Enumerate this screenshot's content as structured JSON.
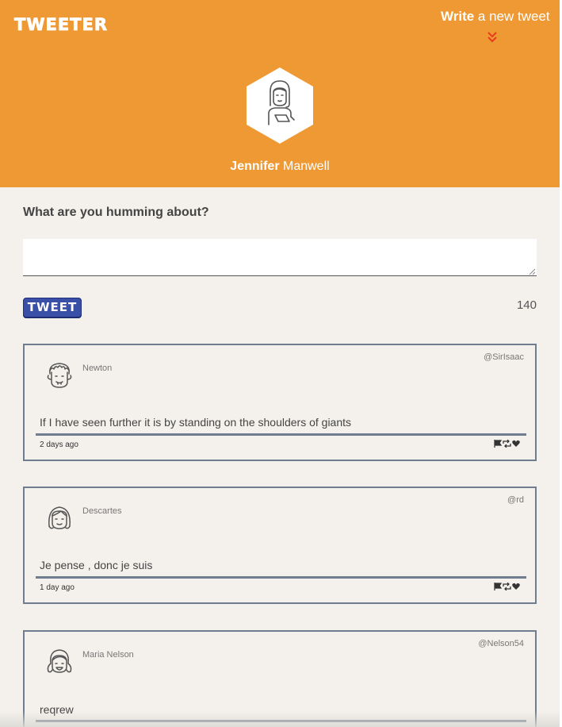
{
  "header": {
    "logo": "TWEETER",
    "write_bold": "Write",
    "write_rest": " a new tweet",
    "profile_first": "Jennifer",
    "profile_last": " Manwell",
    "icons": [
      "chevron-double-down-icon",
      "user-avatar-icon"
    ],
    "accent": "#ee9933"
  },
  "compose": {
    "label": "What are you humming about?",
    "value": "",
    "button": "TWEET",
    "counter": "140",
    "button_color": "#3a4fa6"
  },
  "tweets": [
    {
      "name": "Newton",
      "handle": "@SirIsaac",
      "text": "If I have seen further it is by standing on the shoulders of giants",
      "time": "2 days ago"
    },
    {
      "name": "Descartes",
      "handle": "@rd",
      "text": "Je pense , donc je suis",
      "time": "1 day ago"
    },
    {
      "name": "Maria Nelson",
      "handle": "@Nelson54",
      "text": "reqrew",
      "time": ""
    }
  ]
}
